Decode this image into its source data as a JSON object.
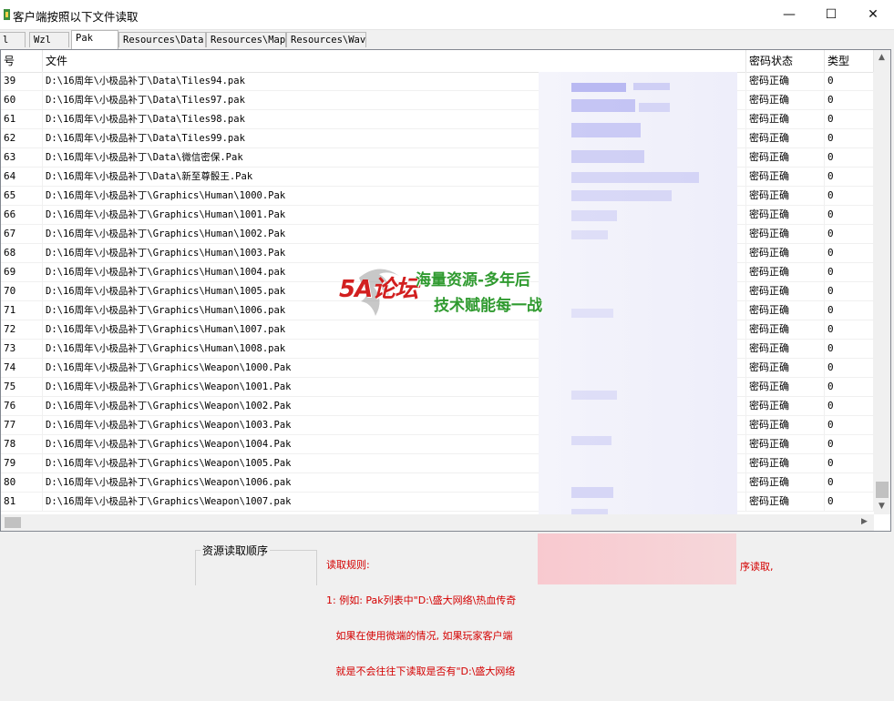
{
  "window": {
    "title": "客户端按照以下文件读取",
    "minimize": "—",
    "maximize": "☐",
    "close": "✕"
  },
  "tabs": [
    {
      "label": "l"
    },
    {
      "label": "Wzl"
    },
    {
      "label": "Pak"
    },
    {
      "label": "Resources\\Data"
    },
    {
      "label": "Resources\\Map"
    },
    {
      "label": "Resources\\Wav"
    }
  ],
  "table": {
    "columns": [
      "号",
      "文件",
      "密码状态",
      "类型"
    ],
    "rows": [
      {
        "num": "39",
        "file": "D:\\16周年\\小极品补丁\\Data\\Tiles94.pak",
        "status": "密码正确",
        "type": "0"
      },
      {
        "num": "60",
        "file": "D:\\16周年\\小极品补丁\\Data\\Tiles97.pak",
        "status": "密码正确",
        "type": "0"
      },
      {
        "num": "61",
        "file": "D:\\16周年\\小极品补丁\\Data\\Tiles98.pak",
        "status": "密码正确",
        "type": "0"
      },
      {
        "num": "62",
        "file": "D:\\16周年\\小极品补丁\\Data\\Tiles99.pak",
        "status": "密码正确",
        "type": "0"
      },
      {
        "num": "63",
        "file": "D:\\16周年\\小极品补丁\\Data\\微信密保.Pak",
        "status": "密码正确",
        "type": "0"
      },
      {
        "num": "64",
        "file": "D:\\16周年\\小极品补丁\\Data\\新至尊骰王.Pak",
        "status": "密码正确",
        "type": "0"
      },
      {
        "num": "65",
        "file": "D:\\16周年\\小极品补丁\\Graphics\\Human\\1000.Pak",
        "status": "密码正确",
        "type": "0"
      },
      {
        "num": "66",
        "file": "D:\\16周年\\小极品补丁\\Graphics\\Human\\1001.Pak",
        "status": "密码正确",
        "type": "0"
      },
      {
        "num": "67",
        "file": "D:\\16周年\\小极品补丁\\Graphics\\Human\\1002.Pak",
        "status": "密码正确",
        "type": "0"
      },
      {
        "num": "68",
        "file": "D:\\16周年\\小极品补丁\\Graphics\\Human\\1003.Pak",
        "status": "密码正确",
        "type": "0"
      },
      {
        "num": "69",
        "file": "D:\\16周年\\小极品补丁\\Graphics\\Human\\1004.pak",
        "status": "密码正确",
        "type": "0"
      },
      {
        "num": "70",
        "file": "D:\\16周年\\小极品补丁\\Graphics\\Human\\1005.pak",
        "status": "密码正确",
        "type": "0"
      },
      {
        "num": "71",
        "file": "D:\\16周年\\小极品补丁\\Graphics\\Human\\1006.pak",
        "status": "密码正确",
        "type": "0"
      },
      {
        "num": "72",
        "file": "D:\\16周年\\小极品补丁\\Graphics\\Human\\1007.pak",
        "status": "密码正确",
        "type": "0"
      },
      {
        "num": "73",
        "file": "D:\\16周年\\小极品补丁\\Graphics\\Human\\1008.pak",
        "status": "密码正确",
        "type": "0"
      },
      {
        "num": "74",
        "file": "D:\\16周年\\小极品补丁\\Graphics\\Weapon\\1000.Pak",
        "status": "密码正确",
        "type": "0"
      },
      {
        "num": "75",
        "file": "D:\\16周年\\小极品补丁\\Graphics\\Weapon\\1001.Pak",
        "status": "密码正确",
        "type": "0"
      },
      {
        "num": "76",
        "file": "D:\\16周年\\小极品补丁\\Graphics\\Weapon\\1002.Pak",
        "status": "密码正确",
        "type": "0"
      },
      {
        "num": "77",
        "file": "D:\\16周年\\小极品补丁\\Graphics\\Weapon\\1003.Pak",
        "status": "密码正确",
        "type": "0"
      },
      {
        "num": "78",
        "file": "D:\\16周年\\小极品补丁\\Graphics\\Weapon\\1004.Pak",
        "status": "密码正确",
        "type": "0"
      },
      {
        "num": "79",
        "file": "D:\\16周年\\小极品补丁\\Graphics\\Weapon\\1005.Pak",
        "status": "密码正确",
        "type": "0"
      },
      {
        "num": "80",
        "file": "D:\\16周年\\小极品补丁\\Graphics\\Weapon\\1006.pak",
        "status": "密码正确",
        "type": "0"
      },
      {
        "num": "81",
        "file": "D:\\16周年\\小极品补丁\\Graphics\\Weapon\\1007.pak",
        "status": "密码正确",
        "type": "0"
      }
    ]
  },
  "bottom": {
    "group_label": "资源读取顺序",
    "rules_title": "读取规则:",
    "rules_line1": "1: 例如: Pak列表中\"D:\\盛大网络\\热血传奇",
    "rules_line2": "   如果在使用微端的情况, 如果玩家客户端",
    "rules_line3": "   就是不会往往下读取是否有\"D:\\盛大网络",
    "rules_tail": "序读取,"
  },
  "watermark": {
    "logo": "5A论坛",
    "line1": "海量资源-多年后",
    "line2": "技术赋能每一战"
  },
  "colors": {
    "rules_text": "#d40000",
    "watermark_green": "#2f9a2f",
    "watermark_red": "#d21f1f"
  }
}
